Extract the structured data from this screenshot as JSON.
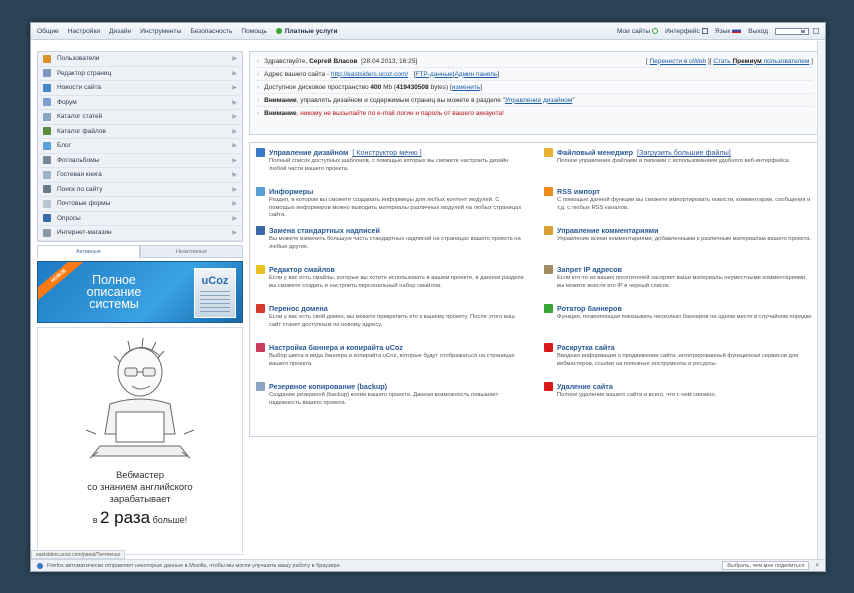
{
  "topmenu": {
    "items": [
      "Общие",
      "Настройки",
      "Дизайн",
      "Инструменты",
      "Безопасность",
      "Помощь"
    ],
    "paid": "Платные услуги",
    "right": [
      "Мои сайты",
      "Интерфейс",
      "Язык",
      "Выход"
    ]
  },
  "sidebar": {
    "items": [
      {
        "label": "Пользователи",
        "icon": "users-icon",
        "color": "#d9932b"
      },
      {
        "label": "Редактор страниц",
        "icon": "page-icon",
        "color": "#7a97c2"
      },
      {
        "label": "Новости сайта",
        "icon": "news-icon",
        "color": "#4a8ac9"
      },
      {
        "label": "Форум",
        "icon": "forum-icon",
        "color": "#7aa0d0"
      },
      {
        "label": "Каталог статей",
        "icon": "articles-icon",
        "color": "#8aa4c4"
      },
      {
        "label": "Каталог файлов",
        "icon": "files-icon",
        "color": "#5b8a3c"
      },
      {
        "label": "Блог",
        "icon": "blog-icon",
        "color": "#5aa0d8"
      },
      {
        "label": "Фотоальбомы",
        "icon": "photo-icon",
        "color": "#7a8a9a"
      },
      {
        "label": "Гостевая книга",
        "icon": "guestbook-icon",
        "color": "#a0b4c8"
      },
      {
        "label": "Поиск по сайту",
        "icon": "search-icon",
        "color": "#6a7a8a"
      },
      {
        "label": "Почтовые формы",
        "icon": "mail-icon",
        "color": "#b8c4d0"
      },
      {
        "label": "Опросы",
        "icon": "poll-icon",
        "color": "#3a6aa8"
      },
      {
        "label": "Интернет-магазин",
        "icon": "shop-icon",
        "color": "#8a9aaa"
      }
    ],
    "tab_active": "Активные",
    "tab_inactive": "Неактивные"
  },
  "banner1": {
    "ribbon": "НОВОЕ",
    "line1": "Полное",
    "line2": "описание",
    "line3": "системы",
    "brand": "uCoz"
  },
  "banner2": {
    "line1": "Вебмастер",
    "line2": "со знанием английского",
    "line3": "зарабатывает",
    "prefix": "в",
    "big": "2 раза",
    "suffix": "больше!"
  },
  "info": {
    "greeting_prefix": "Здравствуйте,",
    "user": "Сергей Власов",
    "datetime": "[28.04.2013, 16:25]",
    "right_link1": "Перенести в uWeb",
    "right_link2_a": "Стать",
    "right_link2_b": "Премиум",
    "right_link2_c": "пользователем",
    "address_label": "Адрес вашего сайта -",
    "address": "http://eastsiders.ucoz.com/",
    "ftp": "FTP-данные",
    "admin": "Админ панель",
    "disk_label": "Доступное дисковое пространство",
    "disk_mb": "400",
    "disk_mb_unit": "Mb",
    "disk_bytes": "419430508",
    "disk_bytes_unit": "bytes)",
    "disk_link": "изменить",
    "notice_bold": "Внимание",
    "notice_text": ", управлять дизайном и содержимым страниц вы можете в разделе",
    "notice_link": "Управление дизайном",
    "warn_bold": "Внимание",
    "warn_text": ", никому не высылайте по e-mail логин и пароль от вашего аккаунта!"
  },
  "sections_left": [
    {
      "title": "Управление дизайном",
      "extra": "[ Конструктор меню ]",
      "desc": "Полный список доступных шаблонов, с помощью которых вы сможете настроить дизайн любой части вашего проекта.",
      "icon": "design-icon",
      "color": "#3a78c8"
    },
    {
      "title": "Информеры",
      "extra": "",
      "desc": "Раздел, в котором вы сможете создавать информеры для любых контент модулей. С помощью информеров можно выводить материалы различных модулей на любых страницах сайта.",
      "icon": "informer-icon",
      "color": "#5aa0d8"
    },
    {
      "title": "Замена стандартных надписей",
      "extra": "",
      "desc": "Вы можете изменить большую часть стандартных надписей на страницах вашего проекта на любые другие.",
      "icon": "replace-icon",
      "color": "#3a6aa8"
    },
    {
      "title": "Редактор смайлов",
      "extra": "",
      "desc": "Если у вас есть смайлы, которые вы хотите использовать в вашем проекте, в данном разделе вы сможете создать и настроить персональный набор смайлов.",
      "icon": "smile-icon",
      "color": "#e8c020"
    },
    {
      "title": "Перенос домена",
      "extra": "",
      "desc": "Если у вас есть свой домен, вы можете прикрепить его к вашему проекту. После этого ваш сайт станет доступным по новому адресу.",
      "icon": "domain-icon",
      "color": "#d83a2a"
    },
    {
      "title": "Настройка баннера и копирайта uCoz",
      "extra": "",
      "desc": "Выбор цвета и вида баннера и копирайта uCoz, которые будут отображаться на страницах вашего проекта.",
      "icon": "banner-icon",
      "color": "#c83a5a"
    },
    {
      "title": "Резервное копирование (backup)",
      "extra": "",
      "desc": "Создание резервной (backup) копии вашего проекта. Данная возможность повышает надежность вашего проекта.",
      "icon": "backup-icon",
      "color": "#8aa4c4"
    }
  ],
  "sections_right": [
    {
      "title": "Файловый менеджер",
      "extra": "[Загрузить большие файлы]",
      "desc": "Полное управление файлами и папками с использованием удобного веб-интерфейса.",
      "icon": "folder-icon",
      "color": "#e8b030"
    },
    {
      "title": "RSS импорт",
      "extra": "",
      "desc": "С помощью данной функции вы сможете импортировать новости, комментарии, сообщения и т.д. с любых RSS каналов.",
      "icon": "rss-icon",
      "color": "#f08a1a"
    },
    {
      "title": "Управление комментариями",
      "extra": "",
      "desc": "Управление всеми комментариями, добавленными к различным материалам вашего проекта.",
      "icon": "comments-icon",
      "color": "#d8a030"
    },
    {
      "title": "Запрет IP адресов",
      "extra": "",
      "desc": "Если кто-то из ваших посетителей засоряет ваши материалы неуместными комментариями, вы можете внести его IP в черный список.",
      "icon": "ban-icon",
      "color": "#a08a60"
    },
    {
      "title": "Ротатор баннеров",
      "extra": "",
      "desc": "Функция, позволяющая показывать несколько баннеров на одном месте в случайном порядке.",
      "icon": "rotator-icon",
      "color": "#3aa636"
    },
    {
      "title": "Раскрутка сайта",
      "extra": "",
      "desc": "Вводная информация о продвижении сайта, интегрированный функционал сервисов для вебмастеров, ссылки на полезные инструменты и ресурсы.",
      "icon": "promo-icon",
      "color": "#d81a1a"
    },
    {
      "title": "Удаление сайта",
      "extra": "",
      "desc": "Полное удаление вашего сайта и всего, что с ним связано.",
      "icon": "delete-icon",
      "color": "#d81a1a"
    }
  ],
  "url_hint": "eastsiders.ucoz.com/panel/?a=menus",
  "status": {
    "text": "Firefox автоматически отправляет некоторые данные в Mozilla, чтобы мы могли улучшить вашу работу в браузере.",
    "button": "Выбрать, чем мне поделиться",
    "close": "×"
  }
}
